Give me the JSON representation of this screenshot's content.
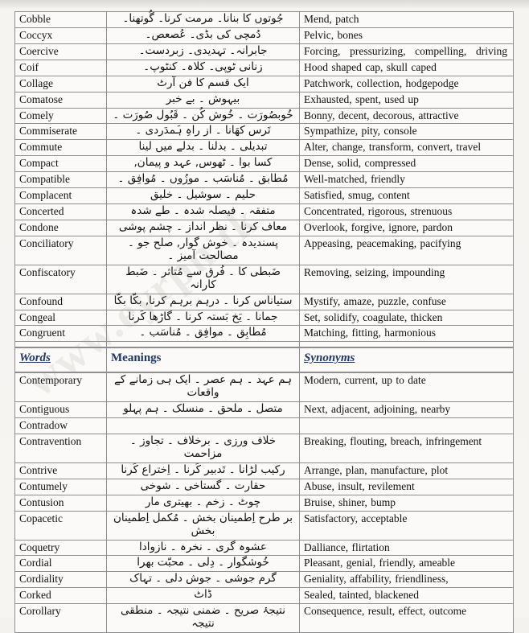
{
  "document": {
    "watermark_text": "www.eyrpn.tk",
    "columns": [
      "Words",
      "Meanings",
      "Synonyms"
    ],
    "header_row": {
      "words_label": "Words",
      "meanings_label": "Meanings",
      "synonyms_label": "Synonyms"
    },
    "rows": [
      {
        "word": "Cobble",
        "meaning": "جُوتوں کا بنانا۔ مرمت کرنا۔ گُوتھنا۔",
        "synonym": "Mend, patch"
      },
      {
        "word": "Coccyx",
        "meaning": "دُمچی کی بڈی۔ عُصعص۔",
        "synonym": "Pelvic, bones"
      },
      {
        "word": "Coercive",
        "meaning": "جابرانہ۔ تہدیدی۔ زبردست۔",
        "synonym": "Forcing, pressurizing, compelling, driving",
        "justify": true
      },
      {
        "word": "Coif",
        "meaning": "زنانی ٹوپی۔ کلاہ۔ کنٹوپ۔",
        "synonym": "Hood shaped cap, skull caped"
      },
      {
        "word": "Collage",
        "meaning": "ایک قسم کا فن آرٹ",
        "synonym": "Patchwork, collection, hodgepodge"
      },
      {
        "word": "Comatose",
        "meaning": "بیہوش ۔ بے خبر",
        "synonym": "Exhausted, spent, used up"
      },
      {
        "word": "Comely",
        "meaning": "خُوبصُورَت ۔ خُوش کُن ۔ قَبُول صُورَت ۔",
        "synonym": "Bonny, decent, decorous, attractive"
      },
      {
        "word": "Commiserate",
        "meaning": "تَرس کھَانا ۔ از راہِ ہَمدَردی ۔",
        "synonym": "Sympathize, pity, console"
      },
      {
        "word": "Commute",
        "meaning": "تبدیلی ۔ بدلنا ۔ بدلے میں لینا",
        "synonym": "Alter, change, transform, convert, travel"
      },
      {
        "word": "Compact",
        "meaning": "کسا بوا ۔ ٹھوس, عہد و پیمان,",
        "synonym": "Dense, solid, compressed"
      },
      {
        "word": "Compatible",
        "meaning": "مُطابق ۔ مُناسَب ۔ موزُوں ۔ مُوافِق ۔",
        "synonym": "Well-matched, friendly"
      },
      {
        "word": "Complacent",
        "meaning": "حلیم ۔ سوشیل ۔ خلیق",
        "synonym": "Satisfied, smug, content"
      },
      {
        "word": "Concerted",
        "meaning": "متفقہ ۔ فیصلہ شدہ ۔ طے شدہ",
        "synonym": "Concentrated, rigorous, strenuous"
      },
      {
        "word": "Condone",
        "meaning": "معاف کرنا ۔ نظر انداز ۔ چشم پوشی",
        "synonym": "Overlook, forgive, ignore, pardon"
      },
      {
        "word": "Conciliatory",
        "meaning": "پسندیدہ ۔ خوش گوار, صلح جو ۔ مصالحت آمیز ۔",
        "synonym": "Appeasing, peacemaking, pacifying"
      },
      {
        "word": "Confiscatory",
        "meaning": "ضَبطی کا ۔ فُرق سے مُتاثر ۔ ضَبط کارانہ",
        "synonym": "Removing, seizing, impounding"
      },
      {
        "word": "Confound",
        "meaning": "ستیاناس کرنا ۔ درہم برہم کرنا, بکّا بکّا",
        "synonym": "Mystify, amaze, puzzle, confuse"
      },
      {
        "word": "Congeal",
        "meaning": "جمانا ۔ یَخ بَستہ کرنا ۔ گاڑھا کَرنا",
        "synonym": "Set, solidify, coagulate, thicken"
      },
      {
        "word": "Congruent",
        "meaning": "مُطابِق ۔ موافِق ۔ مُناسَب ۔",
        "synonym": "Matching, fitting, harmonious"
      },
      {
        "word": "Contemporary",
        "meaning": "ہم عہد ۔ ہم عصر ۔ ایک ہی زمانے کے واقعات",
        "synonym": "Modern, current, up to date"
      },
      {
        "word": "Contiguous",
        "meaning": "متصل ۔ ملحق ۔ منسلک ۔ ہم پہلو",
        "synonym": "Next, adjacent, adjoining, nearby"
      },
      {
        "word": "Contradow",
        "meaning": "",
        "synonym": ""
      },
      {
        "word": "Contravention",
        "meaning": "خلاف ورزی ۔ برخلاف ۔ تجاوز ۔مزاحمت",
        "synonym": "Breaking, flouting, breach, infringement"
      },
      {
        "word": "Contrive",
        "meaning": "رکیب لڑانا ۔ تَدبیر کَرنا ۔ اِختراع کَرنا",
        "synonym": "Arrange, plan, manufacture, plot"
      },
      {
        "word": "Contumely",
        "meaning": "حقارت ۔ گستاخی ۔ شوخی",
        "synonym": "Abuse, insult, revilement"
      },
      {
        "word": "Contusion",
        "meaning": "چوٹ ۔ زخم ۔ بھیتری مار",
        "synonym": "Bruise, shiner, bump"
      },
      {
        "word": "Copacetic",
        "meaning": "بر طرح اِطمینان بخش ۔ مُکمل اِطمینان بخش",
        "synonym": "Satisfactory, acceptable"
      },
      {
        "word": "Coquetry",
        "meaning": "عشوہ گری ۔ نخرہ ۔ نازوادا",
        "synonym": "Dalliance, flirtation"
      },
      {
        "word": "Cordial",
        "meaning": "خُوشگوار ۔ دِلی ۔ محبّت بھرا",
        "synonym": "Pleasant, genial, friendly, ameable"
      },
      {
        "word": "Cordiality",
        "meaning": "گرم جوشی ۔ جوش دلی ۔ تہاک",
        "synonym": "Geniality, affability, friendliness,"
      },
      {
        "word": "Corked",
        "meaning": "ڈاٹ",
        "synonym": "Sealed, tainted, blackened"
      },
      {
        "word": "Corollary",
        "meaning": "نتیجۂ صریح ۔ ضمنی نتیجہ ۔ منطقی نتیجہ",
        "synonym": "Consequence, result, effect, outcome"
      }
    ],
    "header_row_index": 19,
    "colors": {
      "header_text": "#1f3864",
      "border": "#8e8e8e",
      "page_background": "#f4f2ee",
      "table_background": "#fbfaf8",
      "body_text": "#111111"
    }
  }
}
